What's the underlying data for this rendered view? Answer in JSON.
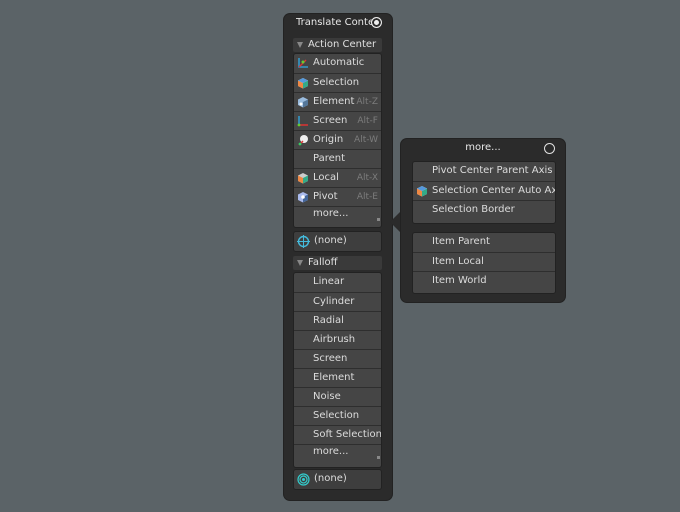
{
  "main_panel": {
    "title": "Translate Contex",
    "action_center": {
      "header": "Action Center",
      "items": [
        {
          "label": "Automatic",
          "key": "",
          "icon": "automatic-icon"
        },
        {
          "label": "Selection",
          "key": "",
          "icon": "selection-cube-icon"
        },
        {
          "label": "Element",
          "key": "Alt-Z",
          "icon": "element-icon"
        },
        {
          "label": "Screen",
          "key": "Alt-F",
          "icon": "screen-axis-icon"
        },
        {
          "label": "Origin",
          "key": "Alt-W",
          "icon": "origin-icon"
        },
        {
          "label": "Parent",
          "key": "",
          "icon": ""
        },
        {
          "label": "Local",
          "key": "Alt-X",
          "icon": "local-icon"
        },
        {
          "label": "Pivot",
          "key": "Alt-E",
          "icon": "pivot-icon"
        },
        {
          "label": "more...",
          "key": "",
          "icon": ""
        }
      ],
      "current": "(none)"
    },
    "falloff": {
      "header": "Falloff",
      "items": [
        "Linear",
        "Cylinder",
        "Radial",
        "Airbrush",
        "Screen",
        "Element",
        "Noise",
        "Selection",
        "Soft Selection",
        "more..."
      ],
      "current": "(none)"
    }
  },
  "more_panel": {
    "title": "more...",
    "group1": [
      {
        "label": "Pivot Center Parent Axis",
        "icon": ""
      },
      {
        "label": "Selection Center Auto Axis",
        "icon": "selection-cube-icon"
      },
      {
        "label": "Selection Border",
        "icon": ""
      }
    ],
    "group2": [
      "Item Parent",
      "Item Local",
      "Item World"
    ]
  },
  "colors": {
    "background": "#5b6367",
    "panel": "#2b2b2b",
    "button": "#454545"
  }
}
